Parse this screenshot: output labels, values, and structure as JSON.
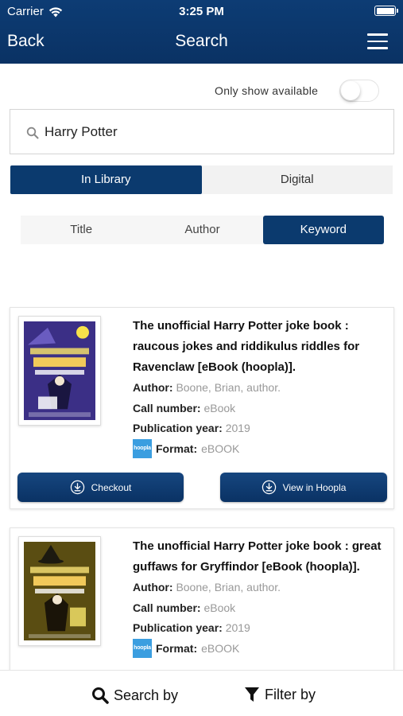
{
  "status_bar": {
    "carrier": "Carrier",
    "time": "3:25 PM"
  },
  "nav": {
    "back_label": "Back",
    "title": "Search"
  },
  "availability": {
    "label": "Only show available",
    "enabled": false
  },
  "search": {
    "query": "Harry Potter"
  },
  "source_tabs": [
    {
      "label": "In Library",
      "active": true
    },
    {
      "label": "Digital",
      "active": false
    }
  ],
  "search_type_tabs": [
    {
      "label": "Title",
      "active": false
    },
    {
      "label": "Author",
      "active": false
    },
    {
      "label": "Keyword",
      "active": true
    }
  ],
  "labels": {
    "author": "Author:",
    "call_number": "Call number:",
    "publication_year": "Publication year:",
    "format": "Format:"
  },
  "results": [
    {
      "title": "The unofficial Harry Potter joke book : raucous jokes and riddikulus riddles for Ravenclaw [eBook (hoopla)].",
      "author": "Boone, Brian, author.",
      "call_number": "eBook",
      "publication_year": "2019",
      "format": "eBOOK",
      "format_badge": "hoopla",
      "cover_color": "#3b2f86",
      "actions": {
        "checkout": "Checkout",
        "view": "View in Hoopla"
      }
    },
    {
      "title": "The unofficial Harry Potter joke book : great guffaws for Gryffindor [eBook (hoopla)].",
      "author": "Boone, Brian, author.",
      "call_number": "eBook",
      "publication_year": "2019",
      "format": "eBOOK",
      "format_badge": "hoopla",
      "cover_color": "#5a4d12"
    }
  ],
  "bottom_bar": {
    "search_by": "Search by",
    "filter_by": "Filter by"
  },
  "colors": {
    "primary": "#0b3a6e",
    "hoopla": "#3b9ee0"
  }
}
